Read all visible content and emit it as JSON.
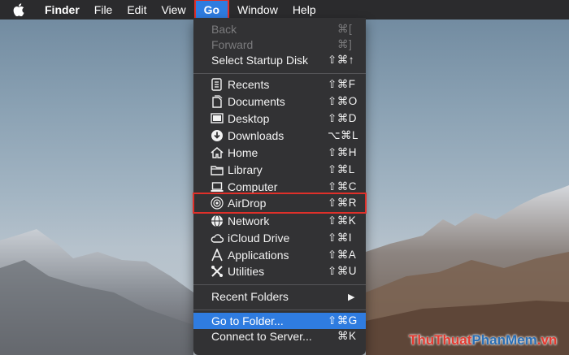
{
  "menubar": {
    "apple_icon": "apple-logo-icon",
    "items": [
      "Finder",
      "File",
      "Edit",
      "View",
      "Go",
      "Window",
      "Help"
    ]
  },
  "go_menu": {
    "back": {
      "label": "Back",
      "shortcut": "⌘["
    },
    "forward": {
      "label": "Forward",
      "shortcut": "⌘]"
    },
    "startup": {
      "label": "Select Startup Disk",
      "shortcut": "⇧⌘↑"
    },
    "recents": {
      "label": "Recents",
      "shortcut": "⇧⌘F",
      "icon": "recents-icon"
    },
    "documents": {
      "label": "Documents",
      "shortcut": "⇧⌘O",
      "icon": "documents-icon"
    },
    "desktop": {
      "label": "Desktop",
      "shortcut": "⇧⌘D",
      "icon": "desktop-icon"
    },
    "downloads": {
      "label": "Downloads",
      "shortcut": "⌥⌘L",
      "icon": "downloads-icon"
    },
    "home": {
      "label": "Home",
      "shortcut": "⇧⌘H",
      "icon": "home-icon"
    },
    "library": {
      "label": "Library",
      "shortcut": "⇧⌘L",
      "icon": "folder-icon"
    },
    "computer": {
      "label": "Computer",
      "shortcut": "⇧⌘C",
      "icon": "computer-icon"
    },
    "airdrop": {
      "label": "AirDrop",
      "shortcut": "⇧⌘R",
      "icon": "airdrop-icon"
    },
    "network": {
      "label": "Network",
      "shortcut": "⇧⌘K",
      "icon": "network-icon"
    },
    "icloud": {
      "label": "iCloud Drive",
      "shortcut": "⇧⌘I",
      "icon": "cloud-icon"
    },
    "applications": {
      "label": "Applications",
      "shortcut": "⇧⌘A",
      "icon": "applications-icon"
    },
    "utilities": {
      "label": "Utilities",
      "shortcut": "⇧⌘U",
      "icon": "utilities-icon"
    },
    "recent_folders": {
      "label": "Recent Folders",
      "submenu_arrow": "▶"
    },
    "go_to_folder": {
      "label": "Go to Folder...",
      "shortcut": "⇧⌘G"
    },
    "connect": {
      "label": "Connect to Server...",
      "shortcut": "⌘K"
    }
  },
  "watermark": {
    "part1": "ThuThuat",
    "part2": "PhanMem",
    "part3": ".vn"
  },
  "colors": {
    "menubar_bg": "#2b2b2d",
    "menu_bg": "#323234",
    "highlight": "#2f7ce0",
    "annotation_box": "#e0302a"
  }
}
